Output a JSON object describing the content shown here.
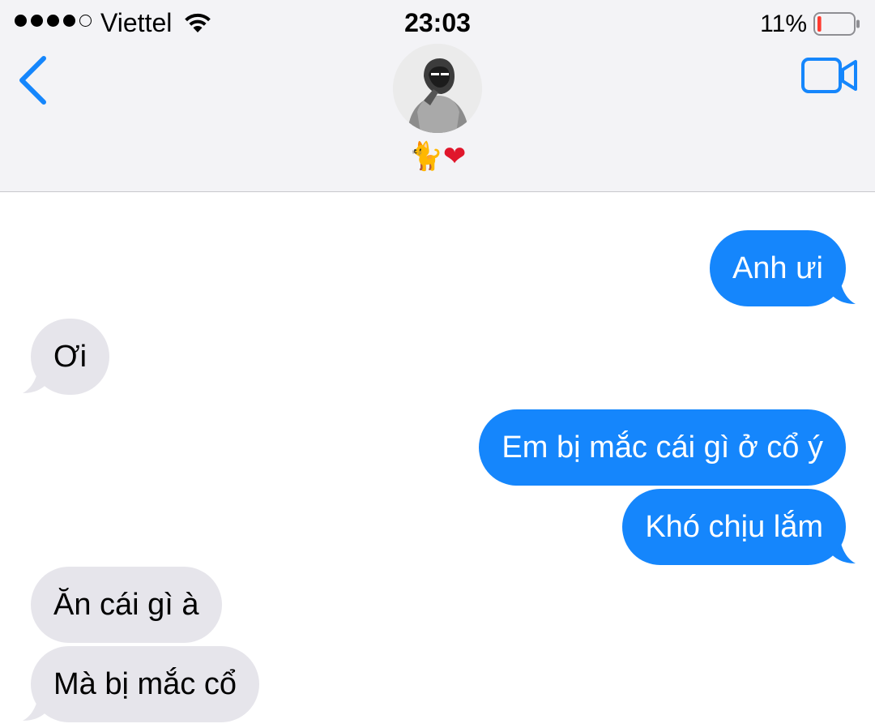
{
  "status_bar": {
    "signal_bars_filled": 4,
    "signal_bars_total": 5,
    "carrier": "Viettel",
    "time": "23:03",
    "battery_percent": "11%",
    "battery_level": 0.11,
    "battery_color": "#ff3b30"
  },
  "conversation": {
    "contact_name": {
      "cat": "🐈",
      "heart": "❤"
    },
    "back_icon": "chevron-left-icon",
    "video_icon": "video-camera-icon"
  },
  "colors": {
    "accent": "#1586fc",
    "incoming_bubble": "#e6e5eb"
  },
  "messages": [
    {
      "direction": "outgoing",
      "text": "Anh ưi"
    },
    {
      "direction": "incoming",
      "text": "Ơi"
    },
    {
      "direction": "outgoing",
      "text": "Em bị mắc cái gì ở cổ ý"
    },
    {
      "direction": "outgoing",
      "text": "Khó chịu lắm"
    },
    {
      "direction": "incoming",
      "text": "Ăn cái gì à"
    },
    {
      "direction": "incoming",
      "text": "Mà bị mắc cổ"
    }
  ]
}
